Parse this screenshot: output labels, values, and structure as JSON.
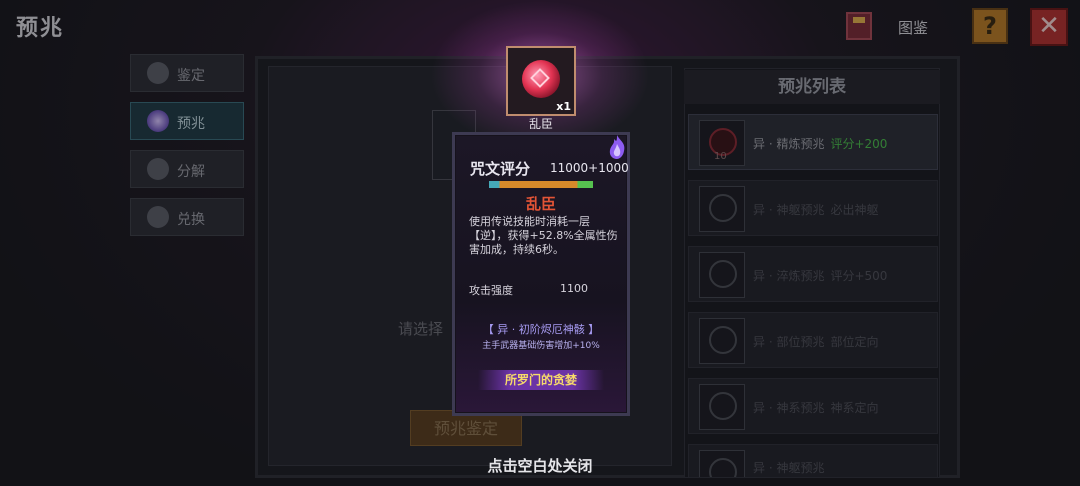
{
  "header": {
    "title": "预兆",
    "atlas_label": "图鉴",
    "help_label": "?",
    "close_label": "✕"
  },
  "tabs": [
    {
      "label": "鉴定",
      "icon": "lamp-icon"
    },
    {
      "label": "预兆",
      "icon": "crystal-ball-icon",
      "active": true
    },
    {
      "label": "分解",
      "icon": "crystal-icon"
    },
    {
      "label": "兑换",
      "icon": "chest-icon"
    }
  ],
  "workspace": {
    "hint": "请选择",
    "appraise_button": "预兆鉴定"
  },
  "top_item": {
    "name": "乱臣",
    "qty": "x1"
  },
  "popup": {
    "title": "咒文评分",
    "score": "11000+1000",
    "name": "乱臣",
    "description": "使用传说技能时消耗一层【逆】，获得+52.8%全属性伤害加成，持续6秒。",
    "stat_label": "攻击强度",
    "stat_value": "1100",
    "set_name": "【 异 · 初阶烬厄神骸 】",
    "set_desc": "主手武器基础伤害增加+10%",
    "source_button": "所罗门的贪婪",
    "close_hint": "点击空白处关闭"
  },
  "omen_list": {
    "title": "预兆列表",
    "rows": [
      {
        "name": "异 · 精炼预兆",
        "bonus": "评分+200",
        "count": "10",
        "active": true
      },
      {
        "name": "异 · 神躯预兆",
        "bonus": "必出神躯",
        "count": ""
      },
      {
        "name": "异 · 淬炼预兆",
        "bonus": "评分+500",
        "count": ""
      },
      {
        "name": "异 · 部位预兆",
        "bonus": "部位定向",
        "count": ""
      },
      {
        "name": "异 · 神系预兆",
        "bonus": "神系定向",
        "count": ""
      },
      {
        "name": "异 · 神躯预兆",
        "bonus": "",
        "count": ""
      }
    ]
  },
  "colors": {
    "rarity_red": "#e25436",
    "bonus_green": "#4bbd4b",
    "set_purple": "#a79bf2",
    "gold": "#f6d96a"
  }
}
